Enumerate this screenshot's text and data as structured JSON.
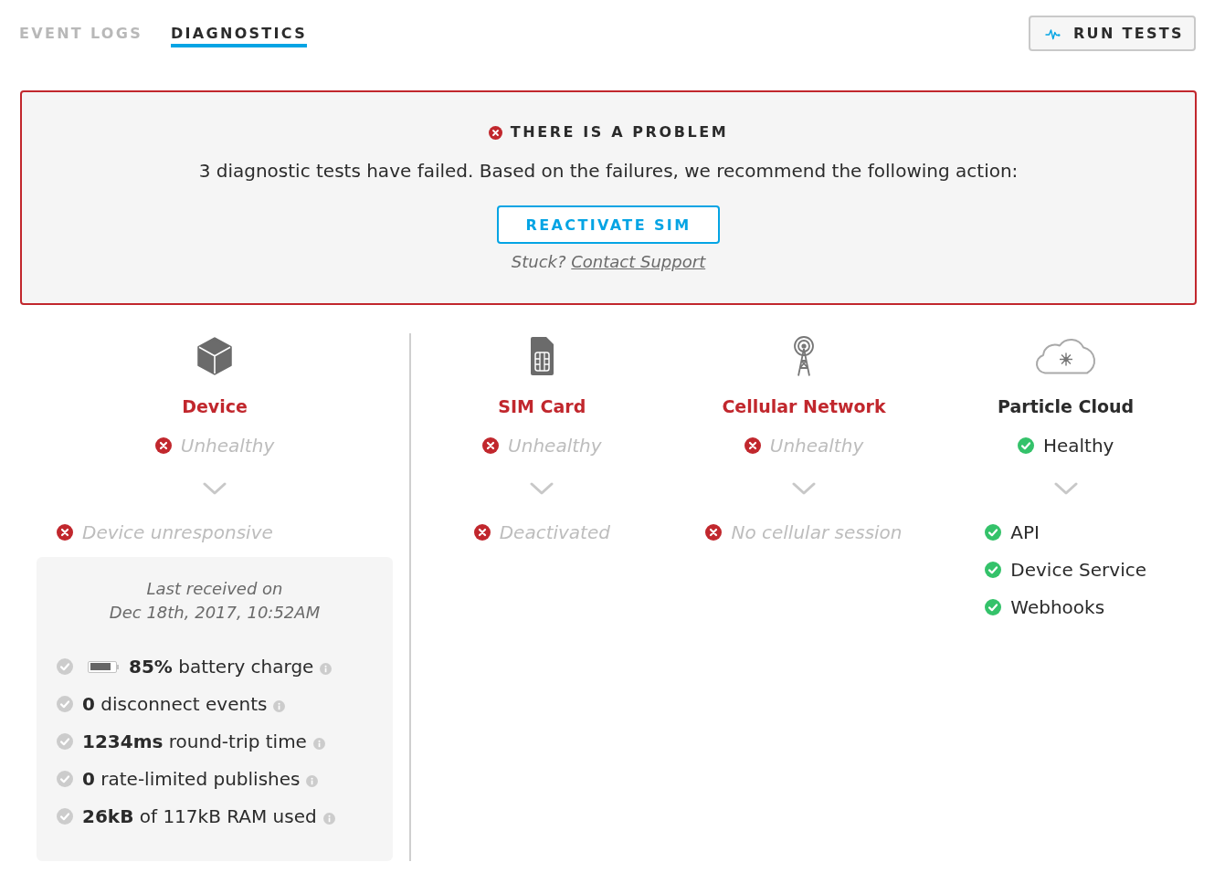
{
  "tabs": [
    {
      "label": "EVENT LOGS",
      "selected": false
    },
    {
      "label": "DIAGNOSTICS",
      "selected": true
    }
  ],
  "run_tests_button": {
    "label": "RUN TESTS"
  },
  "alert": {
    "title": "THERE IS A PROBLEM",
    "message": "3 diagnostic tests have failed. Based on the failures, we recommend the following action:",
    "action_button": "REACTIVATE SIM",
    "help_text": "Stuck?",
    "help_link": "Contact Support"
  },
  "categories": [
    {
      "kind": "device",
      "title": "Device",
      "healthy": false,
      "status": "Unhealthy",
      "checks": [
        {
          "label": "Device unresponsive",
          "passed": false
        }
      ],
      "details": {
        "caption": "Last received on",
        "timestamp": "Dec 18th, 2017, 10:52AM",
        "metrics": [
          {
            "kind": "battery",
            "text": "**85%** battery charge",
            "level": 0.85
          },
          {
            "kind": "plain",
            "text": "**0** disconnect events"
          },
          {
            "kind": "plain",
            "text": "**1234ms** round-trip time"
          },
          {
            "kind": "plain",
            "text": "**0** rate-limited publishes"
          },
          {
            "kind": "plain",
            "text": "**26kB** of 117kB RAM used"
          }
        ]
      }
    },
    {
      "kind": "sim",
      "title": "SIM Card",
      "healthy": false,
      "status": "Unhealthy",
      "checks": [
        {
          "label": "Deactivated",
          "passed": false
        }
      ]
    },
    {
      "kind": "cellular",
      "title": "Cellular Network",
      "healthy": false,
      "status": "Unhealthy",
      "checks": [
        {
          "label": "No cellular session",
          "passed": false
        }
      ]
    },
    {
      "kind": "cloud",
      "title": "Particle Cloud",
      "healthy": true,
      "status": "Healthy",
      "checks": [
        {
          "label": "API",
          "passed": true
        },
        {
          "label": "Device Service",
          "passed": true
        },
        {
          "label": "Webhooks",
          "passed": true
        }
      ]
    }
  ]
}
